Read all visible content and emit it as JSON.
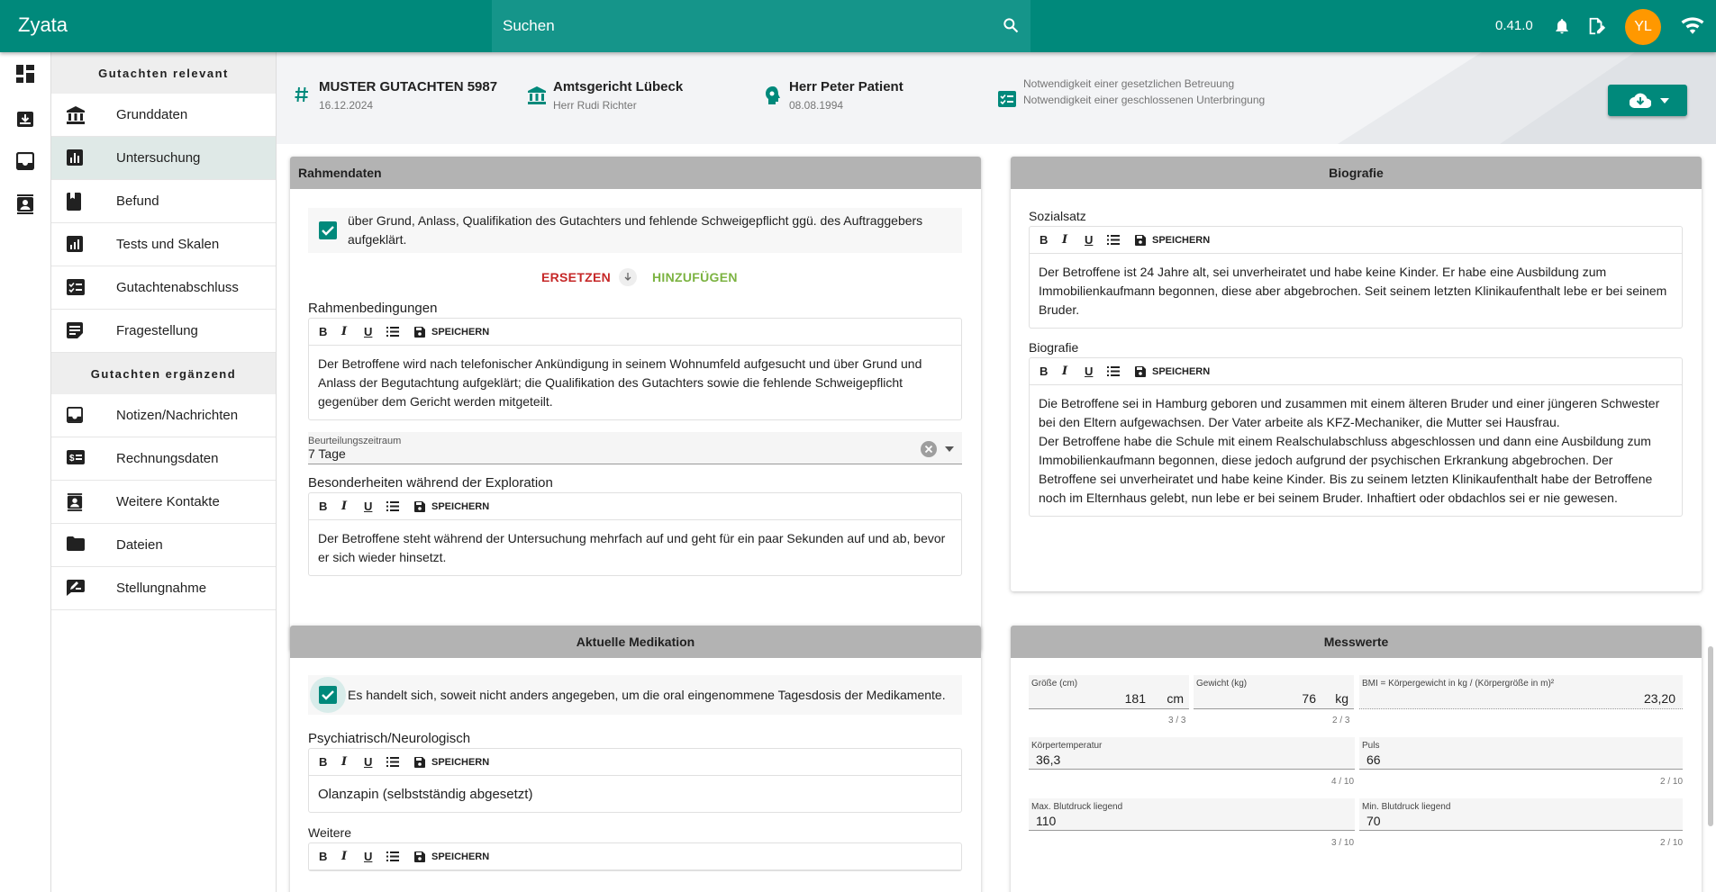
{
  "app": {
    "brand": "Zyata",
    "version": "0.41.0",
    "avatar_initials": "YL",
    "accent": "#00897b",
    "avatar_color": "#ff9800"
  },
  "search": {
    "placeholder": "Suchen"
  },
  "topbar_icons": [
    "bell-icon",
    "edit-document-icon",
    "wifi-icon"
  ],
  "rail_icons": [
    "dashboard-icon",
    "inbox-download-icon",
    "inbox-icon",
    "contacts-icon"
  ],
  "sidebar": {
    "section_relevant": "Gutachten relevant",
    "section_extra": "Gutachten ergänzend",
    "items_relevant": [
      {
        "label": "Grunddaten",
        "icon": "bank-icon"
      },
      {
        "label": "Untersuchung",
        "icon": "bar-chart-icon",
        "active": true
      },
      {
        "label": "Befund",
        "icon": "book-icon"
      },
      {
        "label": "Tests und Skalen",
        "icon": "assessment-icon"
      },
      {
        "label": "Gutachtenabschluss",
        "icon": "checklist-icon"
      },
      {
        "label": "Fragestellung",
        "icon": "note-icon"
      }
    ],
    "items_extra": [
      {
        "label": "Notizen/Nachrichten",
        "icon": "inbox-icon"
      },
      {
        "label": "Rechnungsdaten",
        "icon": "invoice-icon"
      },
      {
        "label": "Weitere Kontakte",
        "icon": "contact-card-icon"
      },
      {
        "label": "Dateien",
        "icon": "folder-icon"
      },
      {
        "label": "Stellungnahme",
        "icon": "rate-review-icon"
      }
    ]
  },
  "case": {
    "title": "MUSTER GUTACHTEN 5987",
    "date": "16.12.2024",
    "court": "Amtsgericht Lübeck",
    "judge": "Herr Rudi Richter",
    "patient": "Herr Peter Patient",
    "birthdate": "08.08.1994",
    "note1": "Notwendigkeit einer gesetzlichen Betreuung",
    "note2": "Notwendigkeit einer geschlossenen Unterbringung"
  },
  "toolbar": {
    "bold": "B",
    "italic": "I",
    "underline": "U",
    "save": "SPEICHERN"
  },
  "rahmendaten": {
    "title": "Rahmendaten",
    "checkbox_text": "über Grund, Anlass, Qualifikation des Gutachters und fehlende Schweigepflicht ggü. des Auftraggebers aufgeklärt.",
    "replace": "ERSETZEN",
    "add": "HINZUFÜGEN",
    "bedingungen_label": "Rahmenbedingungen",
    "bedingungen_text": "Der Betroffene wird nach telefonischer Ankündigung in seinem Wohnumfeld aufgesucht und über Grund und Anlass der Begutachtung aufgeklärt; die Qualifikation des Gutachters sowie die fehlende Schweigepflicht gegenüber dem Gericht werden mitgeteilt.",
    "zeitraum_label": "Beurteilungszeitraum",
    "zeitraum_value": "7 Tage",
    "besonderheiten_label": "Besonderheiten während der Exploration",
    "besonderheiten_text": "Der Betroffene steht während der Untersuchung mehrfach auf und geht für ein paar Sekunden auf und ab, bevor er sich wieder hinsetzt."
  },
  "biografie": {
    "title": "Biografie",
    "sozial_label": "Sozialsatz",
    "sozial_text": "Der Betroffene ist 24 Jahre alt, sei unverheiratet und habe keine Kinder. Er habe eine Ausbildung zum Immobilienkaufmann begonnen, diese aber abgebrochen. Seit seinem letzten Klinikaufenthalt lebe er bei seinem Bruder.",
    "bio_label": "Biografie",
    "bio_text1": "Die Betroffene sei in Hamburg geboren und zusammen mit einem älteren Bruder und einer jüngeren Schwester bei den Eltern aufgewachsen. Der Vater arbeite als KFZ-Mechaniker, die Mutter sei Hausfrau.",
    "bio_text2": "Der Betroffene habe die Schule mit einem Realschulabschluss abgeschlossen und dann eine Ausbildung zum Immobilienkaufmann begonnen, diese jedoch aufgrund der psychischen Erkrankung abgebrochen. Der Betroffene sei unverheiratet und habe keine Kinder. Bis zu seinem letzten Klinikaufenthalt habe der Betroffene noch im Elternhaus gelebt, nun lebe er bei seinem Bruder. Inhaftiert oder obdachlos sei er nie gewesen."
  },
  "medikation": {
    "title": "Aktuelle Medikation",
    "checkbox_text": "Es handelt sich, soweit nicht anders angegeben, um die oral eingenommene Tagesdosis der Medikamente.",
    "psych_label": "Psychiatrisch/Neurologisch",
    "psych_text": "Olanzapin (selbstständig abgesetzt)",
    "weitere_label": "Weitere"
  },
  "messwerte": {
    "title": "Messwerte",
    "groesse_label": "Größe (cm)",
    "groesse_value": "181",
    "groesse_unit": "cm",
    "groesse_counter": "3 / 3",
    "gewicht_label": "Gewicht (kg)",
    "gewicht_value": "76",
    "gewicht_unit": "kg",
    "gewicht_counter": "2 / 3",
    "bmi_label": "BMI = Körpergewicht in kg / (Körpergröße in m)²",
    "bmi_value": "23,20",
    "temp_label": "Körpertemperatur",
    "temp_value": "36,3",
    "temp_counter": "4 / 10",
    "puls_label": "Puls",
    "puls_value": "66",
    "puls_counter": "2 / 10",
    "maxbp_label": "Max. Blutdruck liegend",
    "maxbp_value": "110",
    "maxbp_counter": "3 / 10",
    "minbp_label": "Min. Blutdruck liegend",
    "minbp_value": "70",
    "minbp_counter": "2 / 10"
  }
}
